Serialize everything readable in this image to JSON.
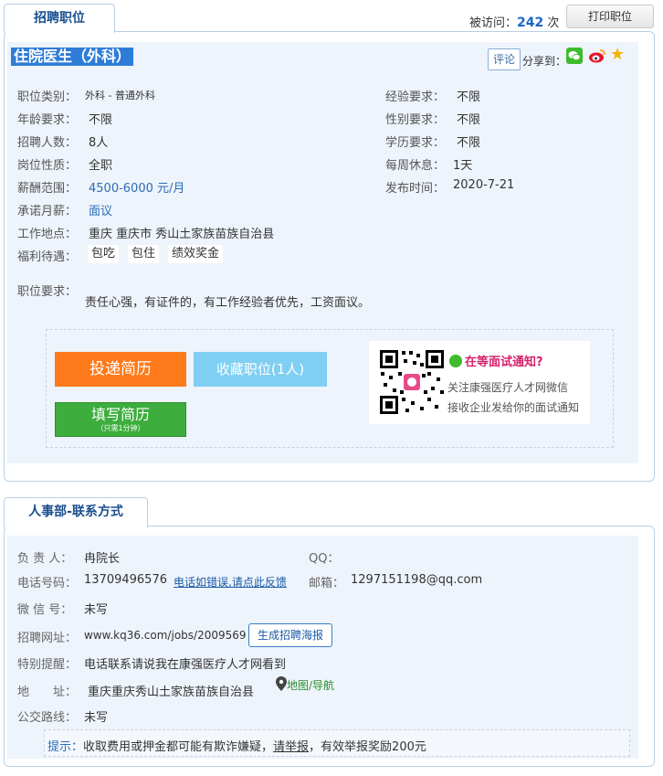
{
  "section1": {
    "tab_label": "招聘职位",
    "visits_label": "被访问：",
    "visits_count": "242",
    "visits_unit": "次",
    "print_label": "打印职位",
    "job_title": "住院医生（外科）",
    "comment_label": "评论",
    "share_label": "分享到：",
    "left_fields": [
      {
        "label": "职位类别：",
        "value": "外科 - 普通外科"
      },
      {
        "label": "年龄要求：",
        "value": "不限"
      },
      {
        "label": "招聘人数：",
        "value": "8人"
      },
      {
        "label": "岗位性质：",
        "value": "全职"
      },
      {
        "label": "薪酬范围：",
        "value": "4500-6000 元/月"
      },
      {
        "label": "承诺月薪：",
        "value": "面议"
      },
      {
        "label": "工作地点：",
        "value": "重庆 重庆市 秀山土家族苗族自治县"
      }
    ],
    "right_fields": [
      {
        "label": "经验要求：",
        "value": "不限"
      },
      {
        "label": "性别要求：",
        "value": "不限"
      },
      {
        "label": "学历要求：",
        "value": "不限"
      },
      {
        "label": "每周休息：",
        "value": "1天"
      },
      {
        "label": "发布时间：",
        "value": "2020-7-21"
      }
    ],
    "benefits_label": "福利待遇：",
    "benefits": [
      "包吃",
      "包住",
      "绩效奖金"
    ],
    "requirements_label": "职位要求：",
    "requirements_text": "责任心强，有证件的，有工作经验者优先，工资面议。",
    "apply_label": "投递简历",
    "favorite_label": "收藏职位(1人)",
    "fill_label": "填写简历",
    "fill_sub": "（只需1分钟）",
    "qr_title": "在等面试通知?",
    "qr_line1": "关注康强医疗人才网微信",
    "qr_line2": "接收企业发给你的面试通知"
  },
  "section2": {
    "tab_label": "人事部-联系方式",
    "contact_label": "负 责 人：",
    "contact_value": "冉院长",
    "qq_label": "QQ：",
    "qq_value": "",
    "phone_label": "电话号码：",
    "phone_value": "13709496576",
    "phone_link": "电话如错误,请点此反馈",
    "email_label": "邮箱：",
    "email_value": "1297151198@qq.com",
    "wechat_label": "微 信 号：",
    "wechat_value": "未写",
    "url_label": "招聘网址：",
    "url_value": "www.kq36.com/jobs/2009569",
    "poster_label": "生成招聘海报",
    "note_label": "特别提醒：",
    "note_value": "电话联系请说我在康强医疗人才网看到",
    "addr_label": "地　　址：",
    "addr_value": "重庆重庆秀山土家族苗族自治县",
    "map_link": "地图/导航",
    "bus_label": "公交路线：",
    "bus_value": "未写",
    "tip_prefix": "提示：",
    "tip_text1": "收取费用或押金都可能有欺诈嫌疑，",
    "tip_link": "请举报",
    "tip_text2": "，有效举报奖励200元"
  },
  "colors": {
    "accent": "#2f7cd8",
    "apply": "#ff7a1a",
    "favorite": "#7fcff3",
    "fill": "#3dae3d"
  }
}
